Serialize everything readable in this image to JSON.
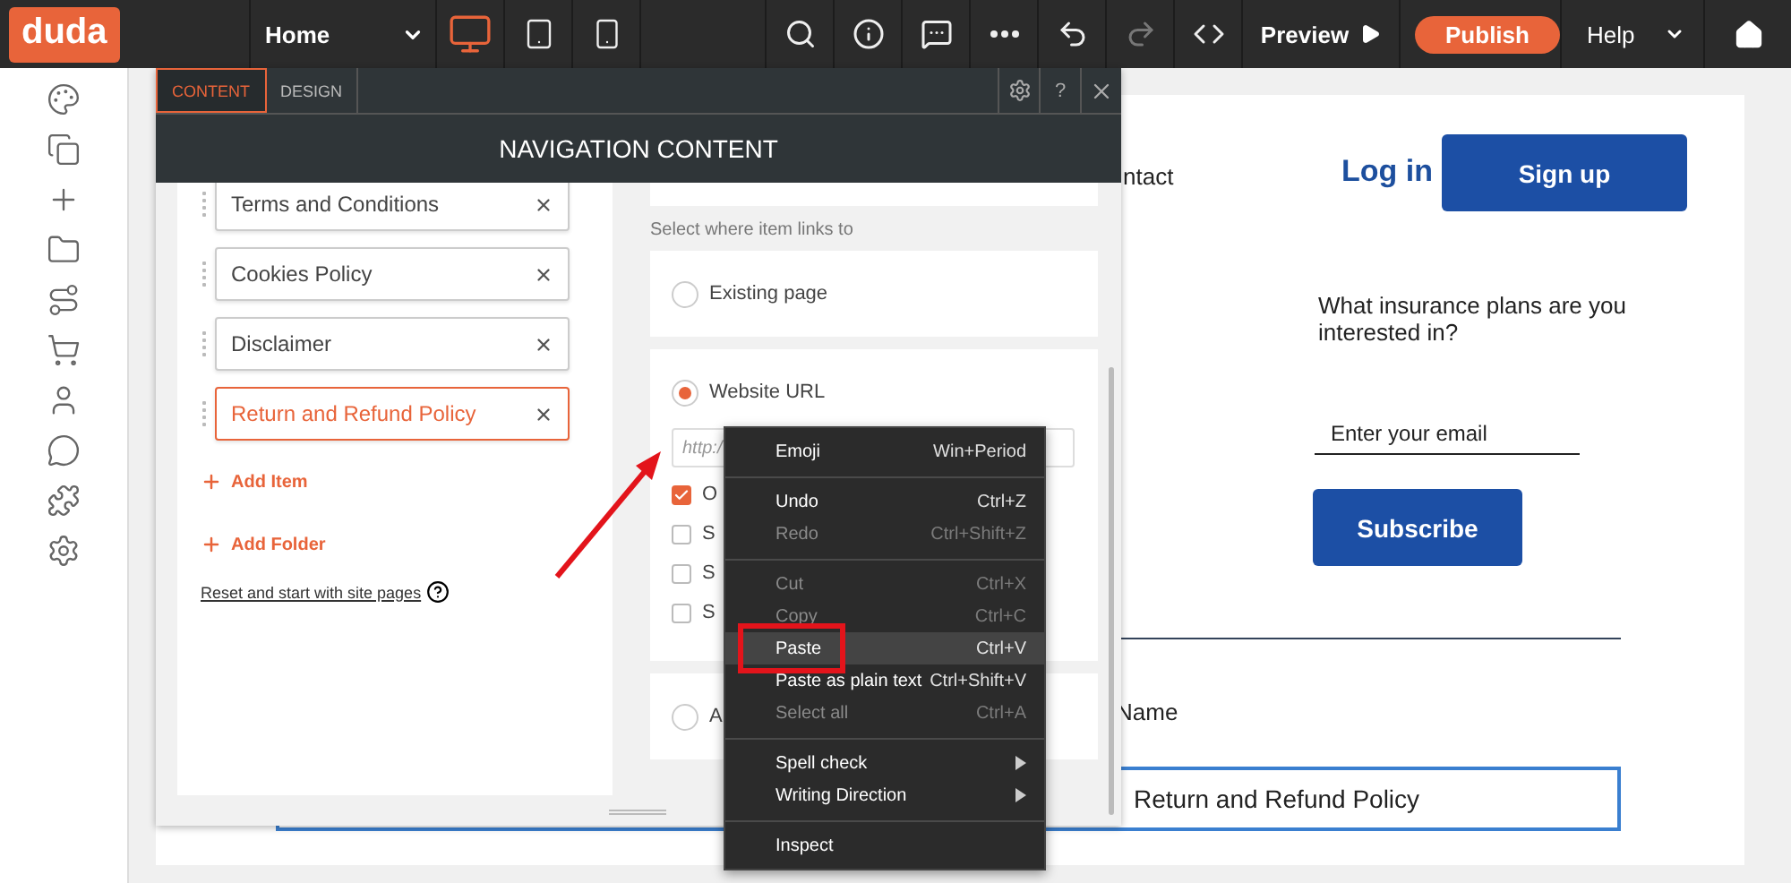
{
  "topbar": {
    "logo": "duda",
    "page_select": "Home",
    "devices": [
      {
        "kind": "desktop",
        "selected": true
      },
      {
        "kind": "tablet",
        "selected": false
      },
      {
        "kind": "mobile",
        "selected": false
      }
    ],
    "tools": [
      {
        "kind": "search",
        "disabled": false
      },
      {
        "kind": "info",
        "disabled": false
      },
      {
        "kind": "comment",
        "disabled": false
      },
      {
        "kind": "more",
        "disabled": false
      },
      {
        "kind": "undo",
        "disabled": false
      },
      {
        "kind": "redo",
        "disabled": true
      },
      {
        "kind": "code",
        "disabled": false
      }
    ],
    "preview": "Preview",
    "publish": "Publish",
    "help": "Help"
  },
  "sidebar": {
    "icons": [
      {
        "kind": "palette"
      },
      {
        "kind": "pages"
      },
      {
        "kind": "add"
      },
      {
        "kind": "folder"
      },
      {
        "kind": "flow"
      },
      {
        "kind": "cart"
      },
      {
        "kind": "user"
      },
      {
        "kind": "chat"
      },
      {
        "kind": "puzzle"
      },
      {
        "kind": "settings"
      }
    ]
  },
  "page": {
    "nav_link": "ntact",
    "login": "Log in",
    "signup": "Sign up",
    "question": "What insurance plans are you interested in?",
    "email_placeholder": "Enter your email",
    "subscribe": "Subscribe",
    "name_label": "Name",
    "name_value": "Return and Refund Policy"
  },
  "panel": {
    "tabs": [
      {
        "label": "CONTENT",
        "selected": true
      },
      {
        "label": "DESIGN",
        "selected": false
      }
    ],
    "help": "?",
    "title": "NAVIGATION CONTENT",
    "nav_items": [
      {
        "label": "Terms and Conditions",
        "selected": false
      },
      {
        "label": "Cookies Policy",
        "selected": false
      },
      {
        "label": "Disclaimer",
        "selected": false
      },
      {
        "label": "Return and Refund Policy",
        "selected": true
      }
    ],
    "add_item": "Add Item",
    "add_folder": "Add Folder",
    "reset_link": "Reset and start with site pages",
    "link_prompt": "Select where item links to",
    "link_options": [
      {
        "label": "Existing page",
        "selected": false
      },
      {
        "label": "Website URL",
        "selected": true,
        "url_placeholder": "http:/",
        "checkboxes": [
          {
            "label": "O",
            "checked": true
          },
          {
            "label": "S",
            "checked": false
          },
          {
            "label": "S",
            "checked": false
          },
          {
            "label": "S",
            "checked": false
          }
        ]
      },
      {
        "label": "A",
        "selected": false
      }
    ]
  },
  "context_menu": {
    "groups": [
      {
        "items": [
          {
            "label": "Emoji",
            "shortcut": "Win+Period",
            "disabled": false,
            "selected": false,
            "outlined": false,
            "submenu": false
          }
        ]
      },
      {
        "items": [
          {
            "label": "Undo",
            "shortcut": "Ctrl+Z",
            "disabled": false,
            "selected": false,
            "outlined": false,
            "submenu": false
          },
          {
            "label": "Redo",
            "shortcut": "Ctrl+Shift+Z",
            "disabled": true,
            "selected": false,
            "outlined": false,
            "submenu": false
          }
        ]
      },
      {
        "items": [
          {
            "label": "Cut",
            "shortcut": "Ctrl+X",
            "disabled": true,
            "selected": false,
            "outlined": false,
            "submenu": false
          },
          {
            "label": "Copy",
            "shortcut": "Ctrl+C",
            "disabled": true,
            "selected": false,
            "outlined": false,
            "submenu": false
          },
          {
            "label": "Paste",
            "shortcut": "Ctrl+V",
            "disabled": false,
            "selected": true,
            "outlined": true,
            "submenu": false
          },
          {
            "label": "Paste as plain text",
            "shortcut": "Ctrl+Shift+V",
            "disabled": false,
            "selected": false,
            "outlined": false,
            "submenu": false
          },
          {
            "label": "Select all",
            "shortcut": "Ctrl+A",
            "disabled": true,
            "selected": false,
            "outlined": false,
            "submenu": false
          }
        ]
      },
      {
        "items": [
          {
            "label": "Spell check",
            "disabled": false,
            "selected": false,
            "outlined": false,
            "submenu": true
          },
          {
            "label": "Writing Direction",
            "disabled": false,
            "selected": false,
            "outlined": false,
            "submenu": true
          }
        ]
      },
      {
        "items": [
          {
            "label": "Inspect",
            "disabled": false,
            "selected": false,
            "outlined": false,
            "submenu": false
          }
        ]
      }
    ]
  }
}
